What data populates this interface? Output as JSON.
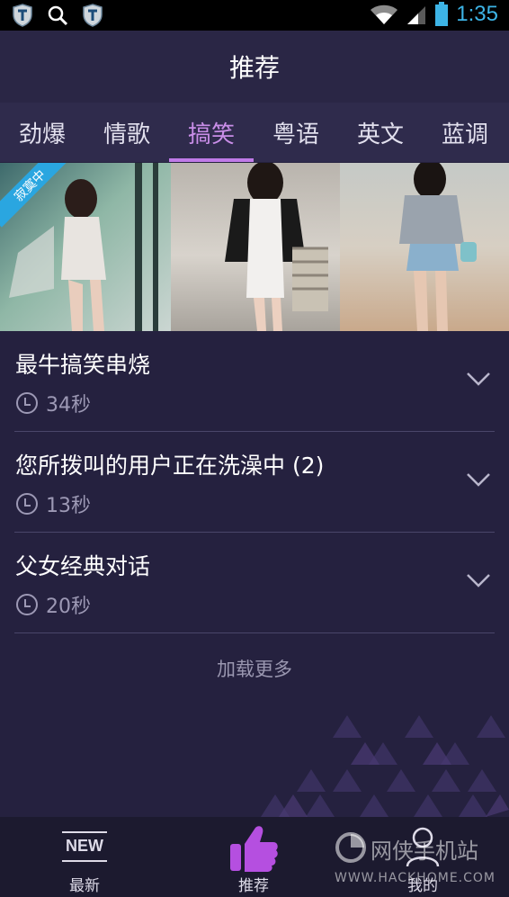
{
  "status_bar": {
    "time": "1:35",
    "icons": [
      "shield-icon",
      "search-icon",
      "shield-icon",
      "wifi-icon",
      "signal-icon",
      "battery-icon"
    ],
    "time_color": "#3db4e6"
  },
  "header": {
    "title": "推荐"
  },
  "tabs": [
    {
      "label": "劲爆"
    },
    {
      "label": "情歌"
    },
    {
      "label": "搞笑",
      "active": true
    },
    {
      "label": "粤语"
    },
    {
      "label": "英文"
    },
    {
      "label": "蓝调"
    }
  ],
  "banner": {
    "badge": "寂寞中"
  },
  "items": [
    {
      "title": "最牛搞笑串烧",
      "duration": "34秒"
    },
    {
      "title": "您所拨叫的用户正在洗澡中 (2)",
      "duration": "13秒"
    },
    {
      "title": "父女经典对话",
      "duration": "20秒"
    }
  ],
  "load_more": "加载更多",
  "bottom_nav": [
    {
      "label": "最新",
      "icon": "new-icon",
      "icon_text": "NEW"
    },
    {
      "label": "推荐",
      "icon": "thumbs-up-icon",
      "active": true
    },
    {
      "label": "我的",
      "icon": "user-icon"
    }
  ],
  "watermark": {
    "line1": "网侠手机站",
    "line2": "WWW.HACKHOME.COM"
  },
  "colors": {
    "accent": "#c07be8",
    "background": "#25213f",
    "header": "#2a2645",
    "tab_bar": "#2f2b4c"
  }
}
